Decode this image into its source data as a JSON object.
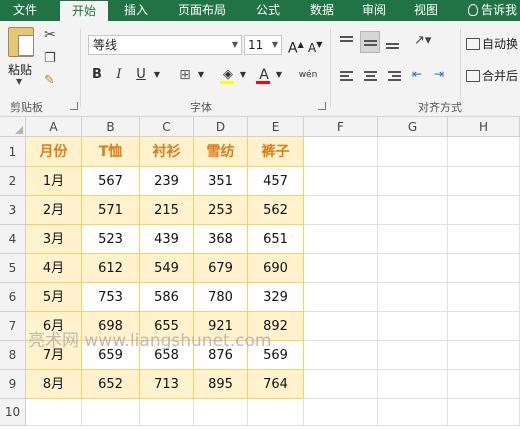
{
  "tabs": [
    "文件",
    "开始",
    "插入",
    "页面布局",
    "公式",
    "数据",
    "审阅",
    "视图"
  ],
  "tell_me": "告诉我",
  "ribbon": {
    "paste_label": "粘贴",
    "clipboard_label": "剪贴板",
    "font_label": "字体",
    "alignment_label": "对齐方式",
    "font_name": "等线",
    "font_size": "11",
    "bold": "B",
    "italic": "I",
    "underline": "U",
    "grow_font": "A",
    "shrink_font": "A",
    "font_color_letter": "A",
    "wen_label": "wén",
    "wrap_text": "自动换",
    "merge_center": "合并后"
  },
  "colors": {
    "accent": "#217346",
    "header_text": "#e07b1a",
    "shade": "#fff2cc",
    "fill_swatch": "#ffff00",
    "font_swatch": "#ff0000"
  },
  "sheet": {
    "columns": [
      "A",
      "B",
      "C",
      "D",
      "E",
      "F",
      "G",
      "H"
    ],
    "row_numbers": [
      "1",
      "2",
      "3",
      "4",
      "5",
      "6",
      "7",
      "8",
      "9",
      "10"
    ],
    "header": [
      "月份",
      "T恤",
      "衬衫",
      "雪纺",
      "裤子"
    ],
    "rows": [
      [
        "1月",
        "567",
        "239",
        "351",
        "457"
      ],
      [
        "2月",
        "571",
        "215",
        "253",
        "562"
      ],
      [
        "3月",
        "523",
        "439",
        "368",
        "651"
      ],
      [
        "4月",
        "612",
        "549",
        "679",
        "690"
      ],
      [
        "5月",
        "753",
        "586",
        "780",
        "329"
      ],
      [
        "6月",
        "698",
        "655",
        "921",
        "892"
      ],
      [
        "7月",
        "659",
        "658",
        "876",
        "569"
      ],
      [
        "8月",
        "652",
        "713",
        "895",
        "764"
      ]
    ]
  },
  "watermark": "亮术网 www.liangshunet.com"
}
